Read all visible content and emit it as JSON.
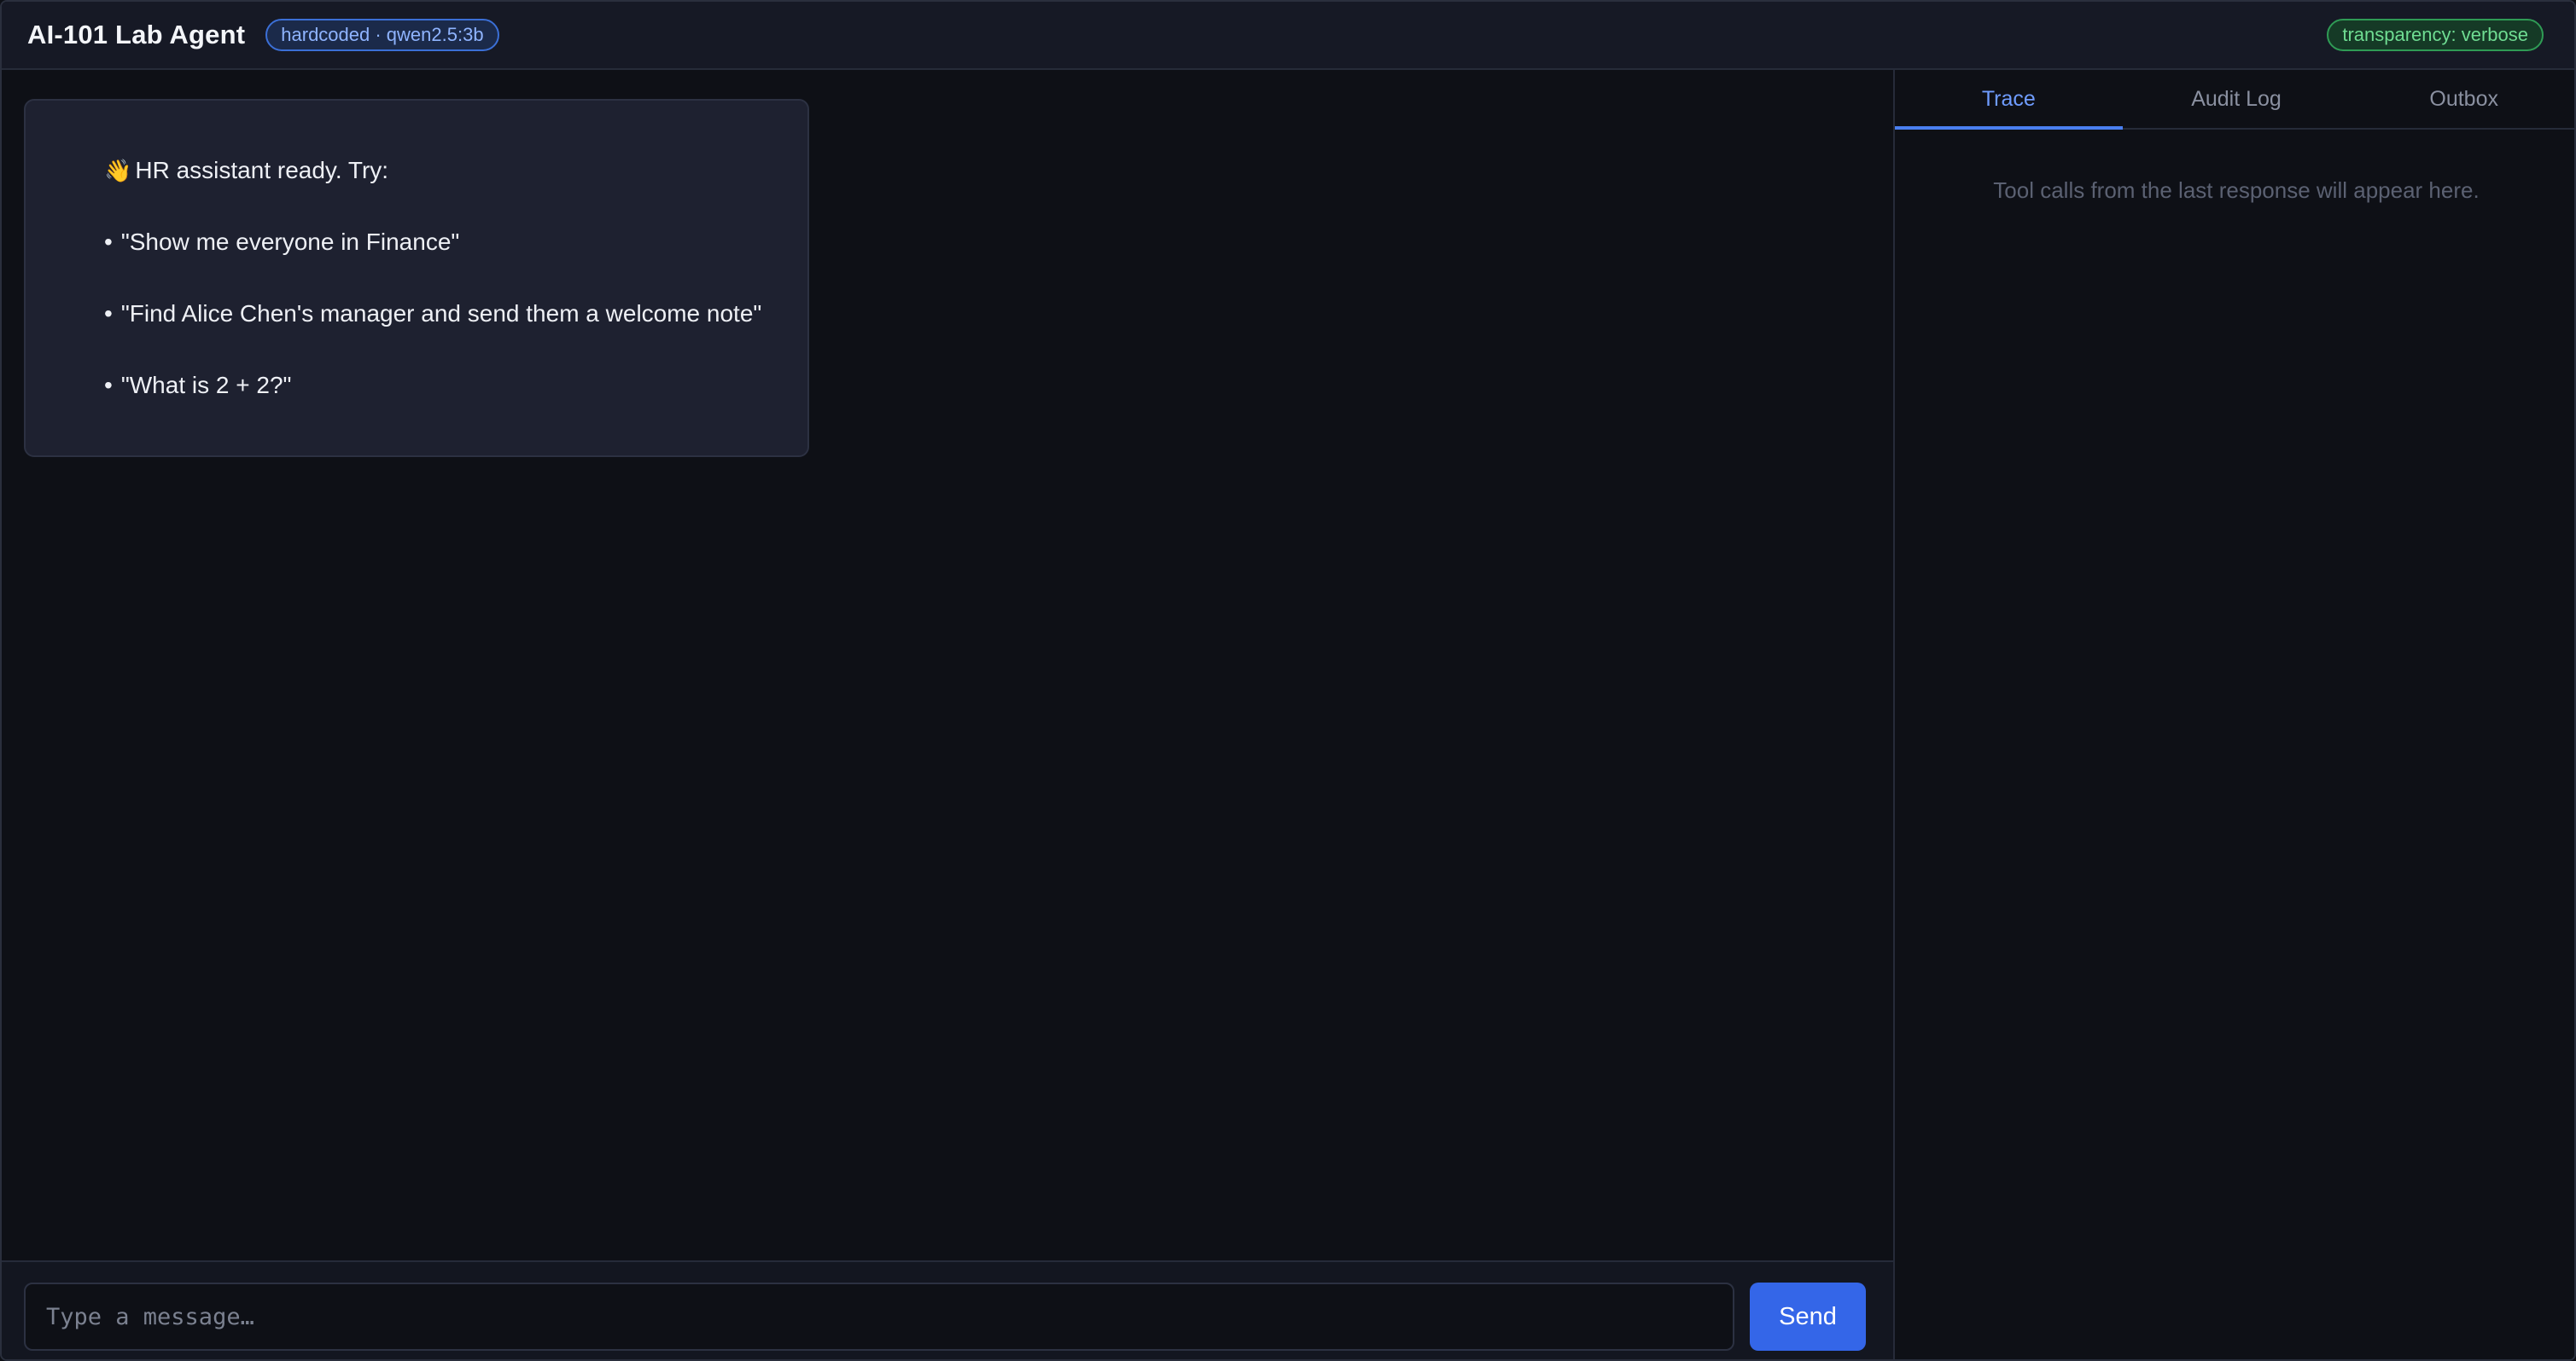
{
  "header": {
    "title": "AI-101 Lab Agent",
    "model_badge": "hardcoded · qwen2.5:3b",
    "transparency_badge": "transparency: verbose"
  },
  "chat": {
    "message": {
      "intro_icon": "👋",
      "intro": "HR assistant ready. Try:",
      "bullet_glyph": "•",
      "suggestions": [
        "\"Show me everyone in Finance\"",
        "\"Find Alice Chen's manager and send them a welcome note\"",
        "\"What is 2 + 2?\""
      ]
    }
  },
  "composer": {
    "placeholder": "Type a message…",
    "value": "",
    "send_label": "Send"
  },
  "side_panel": {
    "tabs": [
      {
        "label": "Trace",
        "active": true
      },
      {
        "label": "Audit Log",
        "active": false
      },
      {
        "label": "Outbox",
        "active": false
      }
    ],
    "empty_text": "Tool calls from the last response will appear here."
  },
  "colors": {
    "accent": "#3466e8",
    "active_tab": "#6f9cff",
    "badge_model": "#3b6fd6",
    "badge_transparency": "#2f9b55"
  }
}
